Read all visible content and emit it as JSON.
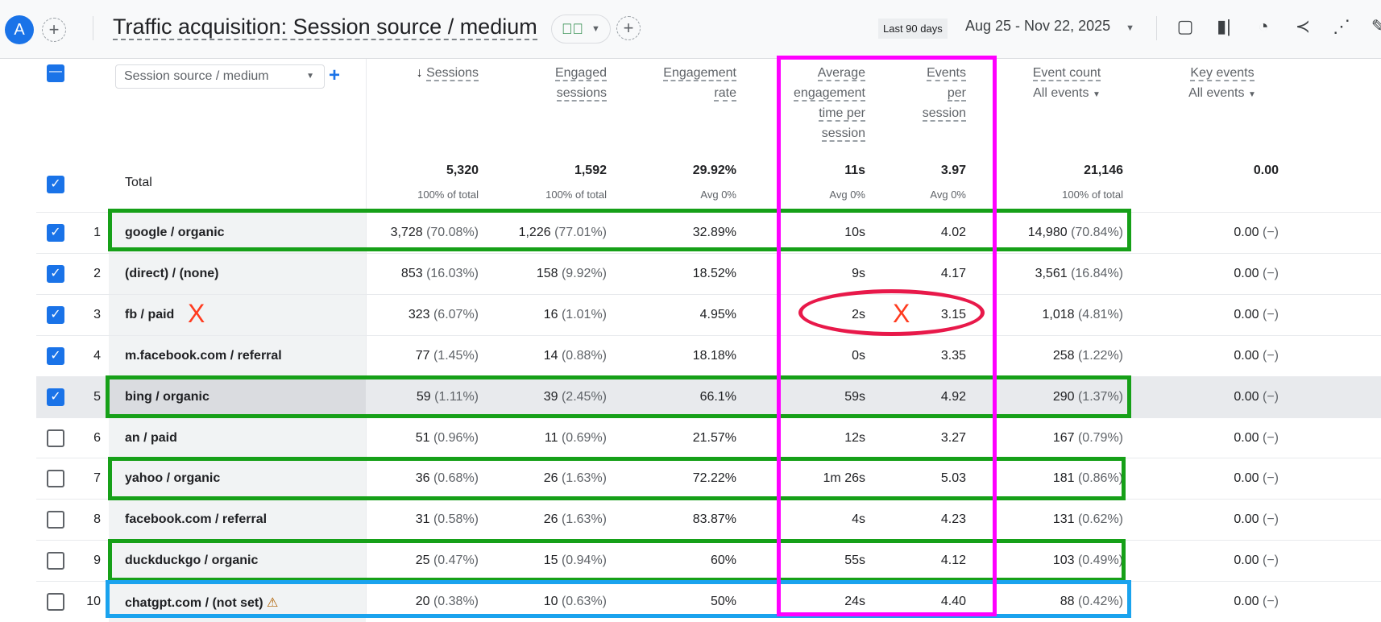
{
  "topbar": {
    "avatar": "A",
    "title": "Traffic acquisition: Session source / medium",
    "date_chip": "Last 90 days",
    "date_range": "Aug 25 - Nov 22, 2025"
  },
  "table": {
    "dimension_selector": "Session source / medium",
    "headers": {
      "sessions": "Sessions",
      "engaged": [
        "Engaged",
        "sessions"
      ],
      "rate": [
        "Engagement",
        "rate"
      ],
      "avg_time": [
        "Average",
        "engagement",
        "time per",
        "session"
      ],
      "events_per": [
        "Events",
        "per",
        "session"
      ],
      "event_count": "Event count",
      "key_events": "Key events",
      "event_filter": "All events",
      "key_filter": "All events"
    },
    "total": {
      "label": "Total",
      "sessions": "5,320",
      "sessions_sub": "100% of total",
      "engaged": "1,592",
      "engaged_sub": "100% of total",
      "rate": "29.92%",
      "rate_sub": "Avg 0%",
      "avg_time": "11s",
      "avg_time_sub": "Avg 0%",
      "events_per": "3.97",
      "events_per_sub": "Avg 0%",
      "event_count": "21,146",
      "event_count_sub": "100% of total",
      "key_events": "0.00"
    },
    "rows": [
      {
        "n": "1",
        "name": "google / organic",
        "s": "3,728",
        "sp": "(70.08%)",
        "e": "1,226",
        "ep": "(77.01%)",
        "r": "32.89%",
        "t": "10s",
        "ev": "4.02",
        "c": "14,980",
        "cp": "(70.84%)",
        "k": "0.00",
        "kp": "(−)",
        "checked": true
      },
      {
        "n": "2",
        "name": "(direct) / (none)",
        "s": "853",
        "sp": "(16.03%)",
        "e": "158",
        "ep": "(9.92%)",
        "r": "18.52%",
        "t": "9s",
        "ev": "4.17",
        "c": "3,561",
        "cp": "(16.84%)",
        "k": "0.00",
        "kp": "(−)",
        "checked": true
      },
      {
        "n": "3",
        "name": "fb / paid",
        "s": "323",
        "sp": "(6.07%)",
        "e": "16",
        "ep": "(1.01%)",
        "r": "4.95%",
        "t": "2s",
        "ev": "3.15",
        "c": "1,018",
        "cp": "(4.81%)",
        "k": "0.00",
        "kp": "(−)",
        "checked": true
      },
      {
        "n": "4",
        "name": "m.facebook.com / referral",
        "s": "77",
        "sp": "(1.45%)",
        "e": "14",
        "ep": "(0.88%)",
        "r": "18.18%",
        "t": "0s",
        "ev": "3.35",
        "c": "258",
        "cp": "(1.22%)",
        "k": "0.00",
        "kp": "(−)",
        "checked": true
      },
      {
        "n": "5",
        "name": "bing / organic",
        "s": "59",
        "sp": "(1.11%)",
        "e": "39",
        "ep": "(2.45%)",
        "r": "66.1%",
        "t": "59s",
        "ev": "4.92",
        "c": "290",
        "cp": "(1.37%)",
        "k": "0.00",
        "kp": "(−)",
        "checked": true
      },
      {
        "n": "6",
        "name": "an / paid",
        "s": "51",
        "sp": "(0.96%)",
        "e": "11",
        "ep": "(0.69%)",
        "r": "21.57%",
        "t": "12s",
        "ev": "3.27",
        "c": "167",
        "cp": "(0.79%)",
        "k": "0.00",
        "kp": "(−)",
        "checked": false
      },
      {
        "n": "7",
        "name": "yahoo / organic",
        "s": "36",
        "sp": "(0.68%)",
        "e": "26",
        "ep": "(1.63%)",
        "r": "72.22%",
        "t": "1m 26s",
        "ev": "5.03",
        "c": "181",
        "cp": "(0.86%)",
        "k": "0.00",
        "kp": "(−)",
        "checked": false
      },
      {
        "n": "8",
        "name": "facebook.com / referral",
        "s": "31",
        "sp": "(0.58%)",
        "e": "26",
        "ep": "(1.63%)",
        "r": "83.87%",
        "t": "4s",
        "ev": "4.23",
        "c": "131",
        "cp": "(0.62%)",
        "k": "0.00",
        "kp": "(−)",
        "checked": false
      },
      {
        "n": "9",
        "name": "duckduckgo / organic",
        "s": "25",
        "sp": "(0.47%)",
        "e": "15",
        "ep": "(0.94%)",
        "r": "60%",
        "t": "55s",
        "ev": "4.12",
        "c": "103",
        "cp": "(0.49%)",
        "k": "0.00",
        "kp": "(−)",
        "checked": false
      },
      {
        "n": "10",
        "name": "chatgpt.com / (not set)",
        "s": "20",
        "sp": "(0.38%)",
        "e": "10",
        "ep": "(0.63%)",
        "r": "50%",
        "t": "24s",
        "ev": "4.40",
        "c": "88",
        "cp": "(0.42%)",
        "k": "0.00",
        "kp": "(−)",
        "checked": false,
        "warning": true
      }
    ]
  },
  "annotations": {
    "x_mark": "X",
    "colors": {
      "green": "#16a018",
      "magenta": "#ff00ff",
      "red": "#e8194a",
      "blue": "#1aa3ee"
    }
  }
}
